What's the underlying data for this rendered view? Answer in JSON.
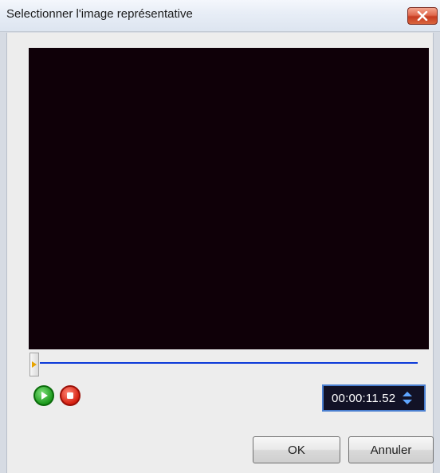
{
  "window": {
    "title": "Selectionner l'image représentative"
  },
  "player": {
    "time": "00:00:11.52",
    "position_fraction": 0.0
  },
  "buttons": {
    "ok_label": "OK",
    "cancel_label": "Annuler"
  },
  "icons": {
    "close": "close-icon",
    "play": "play-icon",
    "stop": "stop-icon",
    "spin_up": "spin-up-icon",
    "spin_down": "spin-down-icon"
  },
  "colors": {
    "video_background": "#0f0008",
    "timeline_track": "#0b3ad8",
    "time_box_background": "#121226",
    "close_button": "#d6462b",
    "play_button": "#1d9a1d",
    "stop_button": "#d62010"
  }
}
